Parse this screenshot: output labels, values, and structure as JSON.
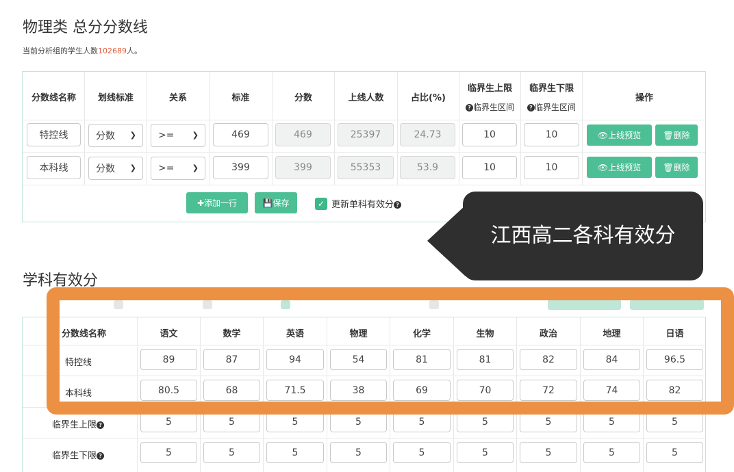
{
  "page": {
    "title": "物理类 总分分数线",
    "student_count_prefix": "当前分析组的学生人数",
    "student_count": "102689",
    "student_count_suffix": "人。"
  },
  "score_table": {
    "headers": [
      "分数线名称",
      "划线标准",
      "关系",
      "标准",
      "分数",
      "上线人数",
      "占比(%)",
      "临界生上限",
      "临界生下限",
      "操作"
    ],
    "sub_upper": "临界生区间",
    "sub_lower": "临界生区间",
    "rows": [
      {
        "name": "特控线",
        "standard_type": "分数",
        "relation": ">=",
        "standard": "469",
        "score": "469",
        "count": "25397",
        "ratio": "24.73",
        "upper": "10",
        "lower": "10"
      },
      {
        "name": "本科线",
        "standard_type": "分数",
        "relation": ">=",
        "standard": "399",
        "score": "399",
        "count": "55353",
        "ratio": "53.9",
        "upper": "10",
        "lower": "10"
      }
    ],
    "preview_label": "上线预览",
    "delete_label": "删除",
    "add_row_label": "添加一行",
    "save_label": "保存",
    "update_label": "更新单科有效分"
  },
  "overlay": {
    "text": "江西高二各科有效分"
  },
  "subject_section": {
    "title": "学科有效分",
    "headers": [
      "分数线名称",
      "语文",
      "数学",
      "英语",
      "物理",
      "化学",
      "生物",
      "政治",
      "地理",
      "日语"
    ],
    "rows": [
      {
        "label": "特控线",
        "values": [
          "89",
          "87",
          "94",
          "54",
          "81",
          "81",
          "82",
          "84",
          "96.5"
        ]
      },
      {
        "label": "本科线",
        "values": [
          "80.5",
          "68",
          "71.5",
          "38",
          "69",
          "70",
          "72",
          "74",
          "82"
        ]
      },
      {
        "label": "临界生上限",
        "values": [
          "5",
          "5",
          "5",
          "5",
          "5",
          "5",
          "5",
          "5",
          "5"
        ]
      },
      {
        "label": "临界生下限",
        "values": [
          "5",
          "5",
          "5",
          "5",
          "5",
          "5",
          "5",
          "5",
          "5"
        ]
      }
    ]
  },
  "colors": {
    "accent": "#4cbf94",
    "overlay_bg": "#2f2f2f",
    "highlight_border": "#ec9044",
    "count_red": "#e05c3a"
  }
}
